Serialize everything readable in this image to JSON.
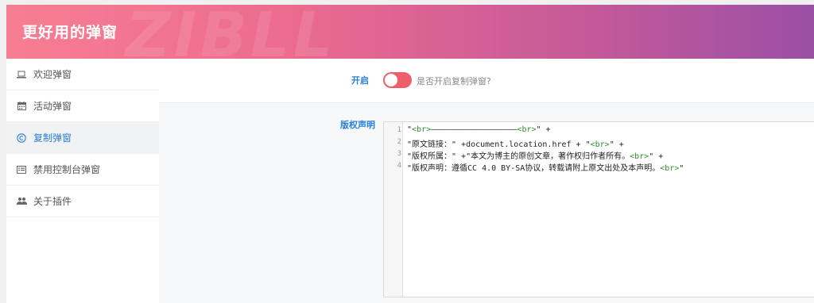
{
  "header": {
    "title": "更好用的弹窗",
    "watermark": "ZIBLL"
  },
  "sidebar": {
    "items": [
      {
        "label": "欢迎弹窗",
        "icon": "laptop-icon",
        "active": false
      },
      {
        "label": "活动弹窗",
        "icon": "calendar-icon",
        "active": false
      },
      {
        "label": "复制弹窗",
        "icon": "copyright-icon",
        "active": true
      },
      {
        "label": "禁用控制台弹窗",
        "icon": "console-icon",
        "active": false
      },
      {
        "label": "关于插件",
        "icon": "users-icon",
        "active": false
      }
    ]
  },
  "settings": {
    "enable": {
      "label": "开启",
      "hint": "是否开启复制弹窗?",
      "value": "on"
    },
    "copyright": {
      "label": "版权声明",
      "lines": [
        {
          "num": "1",
          "parts": [
            {
              "text": "\"",
              "tag": false
            },
            {
              "text": "<br>",
              "tag": true
            },
            {
              "text": "——————————————————",
              "tag": false
            },
            {
              "text": "<br>",
              "tag": true
            },
            {
              "text": "\" +",
              "tag": false
            }
          ]
        },
        {
          "num": "2",
          "parts": [
            {
              "text": "\"原文链接：\" +document.location.href + \"",
              "tag": false
            },
            {
              "text": "<br>",
              "tag": true
            },
            {
              "text": "\" +",
              "tag": false
            }
          ]
        },
        {
          "num": "3",
          "parts": [
            {
              "text": "\"版权所属：\" +\"本文为博主的原创文章，著作权归作者所有。",
              "tag": false
            },
            {
              "text": "<br>",
              "tag": true
            },
            {
              "text": "\" +",
              "tag": false
            }
          ]
        },
        {
          "num": "4",
          "parts": [
            {
              "text": "\"版权声明：遵循CC 4.0 BY-SA协议，转载请附上原文出处及本声明。",
              "tag": false
            },
            {
              "text": "<br>",
              "tag": true
            },
            {
              "text": "\"",
              "tag": false
            }
          ]
        }
      ]
    }
  },
  "colors": {
    "accent": "#2a7fd9",
    "toggle_on": "#ef5f6b",
    "header_start": "#f77e92",
    "header_end": "#9b4fa6",
    "code_tag": "#2e8b2e"
  }
}
